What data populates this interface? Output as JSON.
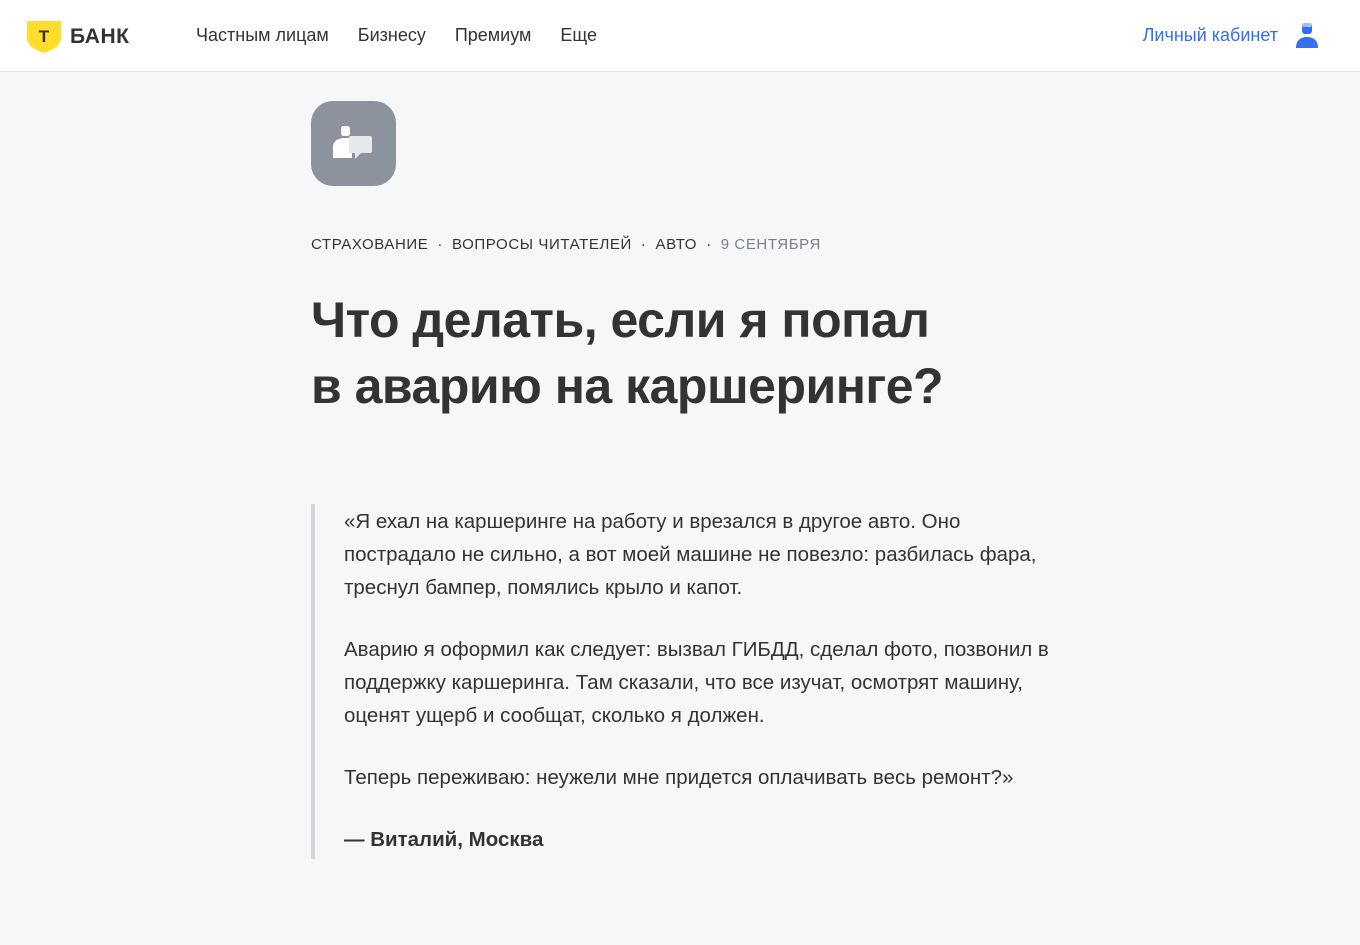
{
  "header": {
    "logo_text": "БАНК",
    "logo_letter": "Т",
    "nav": [
      "Частным лицам",
      "Бизнесу",
      "Премиум",
      "Еще"
    ],
    "account_label": "Личный кабинет"
  },
  "article": {
    "category_icon": "readers-questions-icon",
    "tags": [
      "СТРАХОВАНИЕ",
      "ВОПРОСЫ ЧИТАТЕЛЕЙ",
      "АВТО"
    ],
    "separator": "·",
    "date": "9 СЕНТЯБРЯ",
    "title_line1": "Что делать, если я попал",
    "title_line2": "в аварию на каршеринге?",
    "quote_paragraphs": [
      "«Я ехал на каршеринге на работу и врезался в другое авто. Оно пострадало не сильно, а вот моей машине не повезло: разбилась фара, треснул бампер, помялись крыло и капот.",
      "Аварию я оформил как следует: вызвал ГИБДД, сделал фото, позвонил в поддержку каршеринга. Там сказали, что все изучат, осмотрят машину, оценят ущерб и сообщат, сколько я должен.",
      "Теперь переживаю: неужели мне придется оплачивать весь ремонт?»"
    ],
    "quote_author": "— Виталий, Москва"
  },
  "colors": {
    "brand_yellow": "#ffdd2d",
    "link_blue": "#336fee",
    "page_bg": "#f6f7f8",
    "icon_tile": "#8d939c"
  }
}
